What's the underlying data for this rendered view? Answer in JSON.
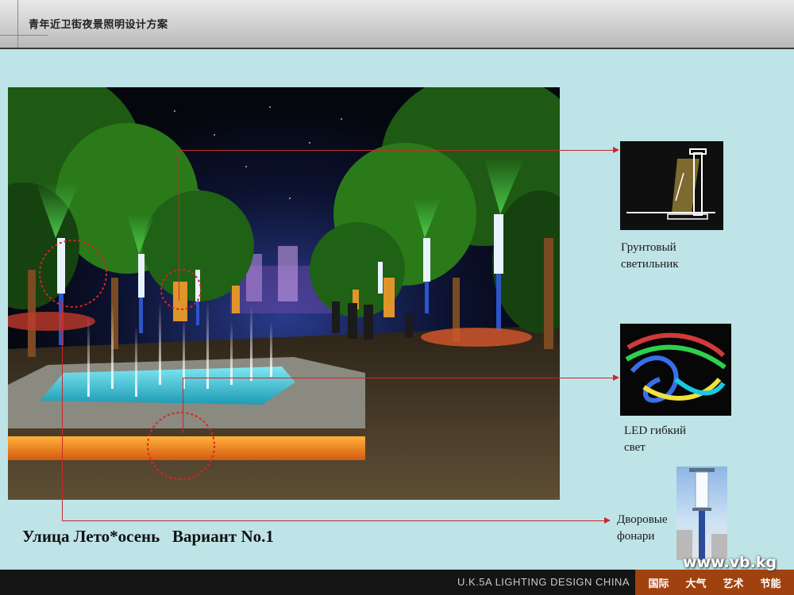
{
  "header": {
    "title": "青年近卫街夜景照明设计方案"
  },
  "main": {
    "variant_title": "Улица Лето*осень   Вариант No.1",
    "callouts": [
      {
        "caption_line1": "Грунтовый",
        "caption_line2": "светильник",
        "thumb_icon": "ground-spotlight-sketch"
      },
      {
        "caption_line1": "LED гибкий",
        "caption_line2": "свет",
        "thumb_icon": "led-flexible-strip"
      },
      {
        "caption_line1": "Дворовые",
        "caption_line2": "фонари",
        "thumb_icon": "courtyard-lamp-post"
      }
    ],
    "accent_color": "#c8282c"
  },
  "footer": {
    "brand": "U.K.5A LIGHTING DESIGN CHINA",
    "slogans": [
      "国际",
      "大气",
      "艺术",
      "节能"
    ],
    "slogan_bg": "#a0420f"
  },
  "watermark": "www.vb.kg"
}
